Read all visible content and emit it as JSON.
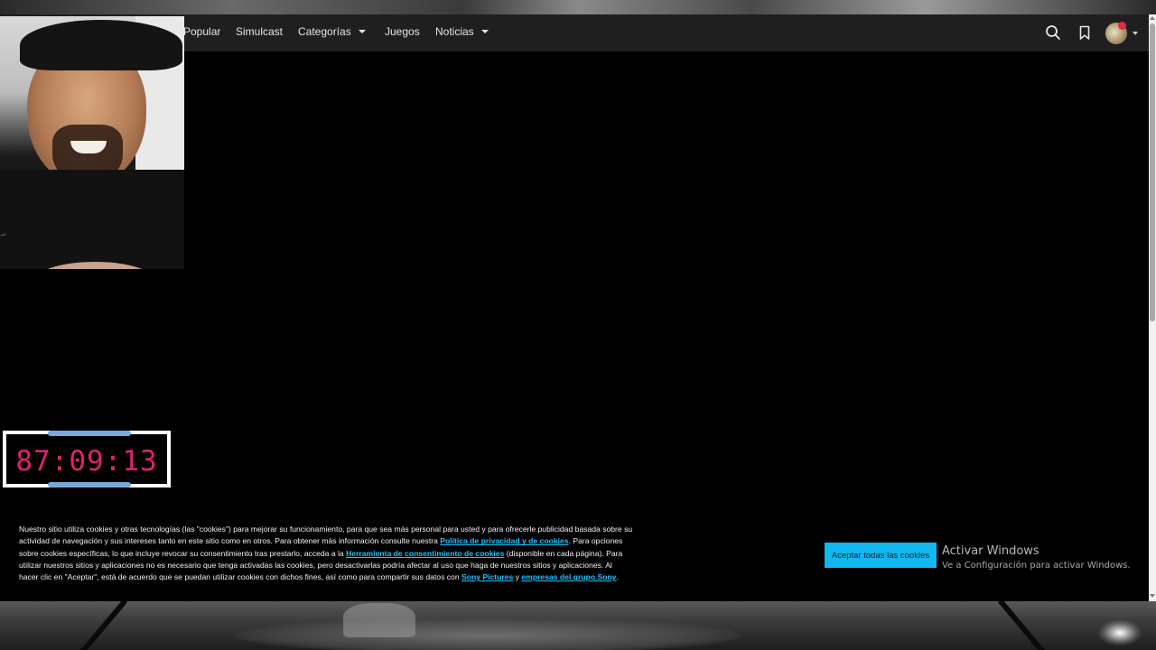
{
  "nav": {
    "items": [
      {
        "label": "Popular"
      },
      {
        "label": "Simulcast"
      },
      {
        "label": "Categorías"
      },
      {
        "label": "Juegos"
      },
      {
        "label": "Noticias"
      }
    ],
    "icons": {
      "search": "search-icon",
      "bookmark": "bookmark-icon",
      "avatar": "profile-avatar"
    }
  },
  "timer": {
    "value": "87:09:13"
  },
  "cookie": {
    "text_1": "Nuestro sitio utiliza cookies y otras tecnologías (las \"cookies\") para mejorar su funcionamiento, para que sea más personal para usted y para ofrecerle publicidad basada sobre su actividad de navegación y sus intereses tanto en este sitio como en otros. Para obtener más información consulte nuestra ",
    "link_privacy": "Política de privacidad y de cookies",
    "text_2": ". Para opciones sobre cookies específicas, lo que incluye revocar su consentimiento tras prestarlo, acceda a la ",
    "link_tool": "Herramienta de consentimiento de cookies",
    "text_3": " (disponible en cada página). Para utilizar nuestros sitios y aplicaciones no es necesario que tenga activadas las cookies, pero desactivarlas podría afectar al uso que haga de nuestros sitios y aplicaciones. Al hacer clic en \"Aceptar\", está de acuerdo que se puedan utilizar cookies con dichos fines, así como para compartir sus datos con ",
    "link_sony": "Sony Pictures",
    "text_4": " y ",
    "link_group": "empresas del grupo Sony",
    "text_5": ".",
    "accept_label": "Aceptar todas las cookies"
  },
  "windows": {
    "title": "Activar Windows",
    "subtitle": "Ve a Configuración para activar Windows."
  },
  "colors": {
    "timer": "#e0226e",
    "link": "#1ec3ff",
    "accept_button": "#12b8ef",
    "avatar_badge": "#e02a40"
  }
}
